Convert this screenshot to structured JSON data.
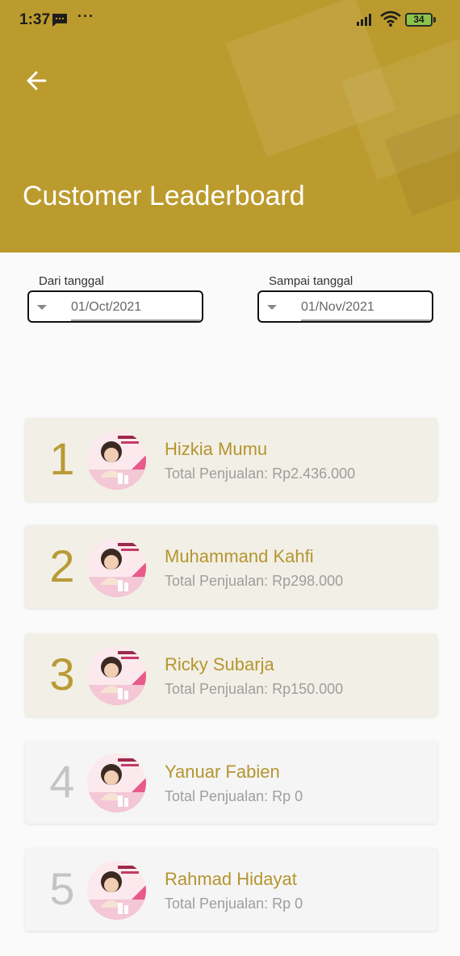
{
  "status_bar": {
    "time": "1:37",
    "more": "···",
    "battery": "34"
  },
  "header": {
    "title": "Customer Leaderboard",
    "color": "#bc9b2e"
  },
  "filters": {
    "from_label": "Dari tanggal",
    "from_value": "01/Oct/2021",
    "to_label": "Sampai tanggal",
    "to_value": "01/Nov/2021"
  },
  "leaderboard": [
    {
      "rank": "1",
      "name": "Hizkia Mumu",
      "sales_label": "Total Penjualan: ",
      "sales_value": "Rp2.436.000"
    },
    {
      "rank": "2",
      "name": "Muhammand Kahfi",
      "sales_label": "Total Penjualan: ",
      "sales_value": "Rp298.000"
    },
    {
      "rank": "3",
      "name": "Ricky Subarja",
      "sales_label": "Total Penjualan: ",
      "sales_value": "Rp150.000"
    },
    {
      "rank": "4",
      "name": "Yanuar Fabien",
      "sales_label": "Total Penjualan: ",
      "sales_value": "Rp 0"
    },
    {
      "rank": "5",
      "name": "Rahmad Hidayat",
      "sales_label": "Total Penjualan: ",
      "sales_value": "Rp 0"
    }
  ],
  "colors": {
    "accent": "#b5952f",
    "top_card": "#f2efe6",
    "rest_card": "#f5f5f5"
  }
}
